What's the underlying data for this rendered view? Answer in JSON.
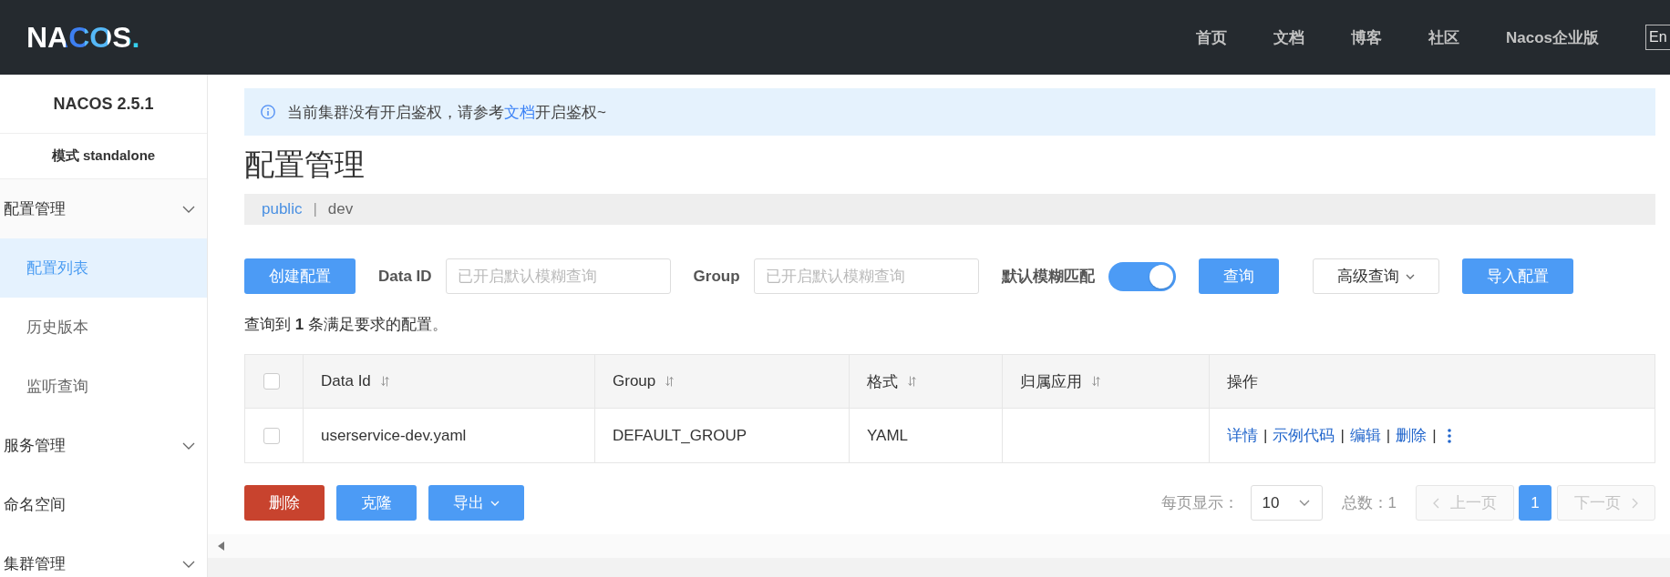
{
  "header": {
    "logo": "NACOS.",
    "nav": [
      {
        "label": "首页"
      },
      {
        "label": "文档"
      },
      {
        "label": "博客"
      },
      {
        "label": "社区"
      },
      {
        "label": "Nacos企业版"
      }
    ],
    "language": "En"
  },
  "sidebar": {
    "version": "NACOS 2.5.1",
    "mode": "模式 standalone",
    "items": [
      {
        "kind": "group",
        "label": "配置管理",
        "children": [
          {
            "label": "配置列表",
            "selected": true
          },
          {
            "label": "历史版本",
            "selected": false
          },
          {
            "label": "监听查询",
            "selected": false
          }
        ]
      },
      {
        "kind": "group",
        "label": "服务管理"
      },
      {
        "kind": "link",
        "label": "命名空间",
        "selected": false
      },
      {
        "kind": "group",
        "label": "集群管理"
      }
    ]
  },
  "notice": {
    "text_before": "当前集群没有开启鉴权，请参考",
    "link": "文档",
    "text_after": "开启鉴权~"
  },
  "page_title": "配置管理",
  "breadcrumb": {
    "namespaces": [
      {
        "label": "public",
        "selected": false
      },
      {
        "label": "dev",
        "selected": true
      }
    ],
    "separator": "|"
  },
  "toolbar": [
    {
      "kind": "primary",
      "label": "创建配置"
    },
    {
      "kind": "field",
      "label": "Data ID",
      "placeholder": "已开启默认模糊查询"
    },
    {
      "kind": "field",
      "label": "Group",
      "placeholder": "已开启默认模糊查询"
    },
    {
      "kind": "toggle",
      "label": "默认模糊匹配",
      "on": true
    },
    {
      "kind": "primary",
      "label": "查询"
    },
    {
      "kind": "secondary",
      "label": "高级查询",
      "dropdown": true
    },
    {
      "kind": "primary",
      "label": "导入配置"
    }
  ],
  "result_summary": "查询到 **1** 条满足要求的配置。",
  "table": {
    "select_all": {
      "checked": false
    },
    "columns": [
      {
        "label": "Data Id",
        "sortable": true
      },
      {
        "label": "Group",
        "sortable": true
      },
      {
        "label": "格式",
        "sortable": true
      },
      {
        "label": "归属应用",
        "sortable": true
      },
      {
        "label": "操作",
        "sortable": false
      }
    ],
    "rows": [
      {
        "checked": false,
        "data_id": "userservice-dev.yaml",
        "group": "DEFAULT_GROUP",
        "format": "YAML",
        "actions": [
          {
            "kind": "link",
            "label": "详情"
          },
          {
            "kind": "separator",
            "label": "|"
          },
          {
            "kind": "link",
            "label": "示例代码"
          },
          {
            "kind": "separator",
            "label": "|"
          },
          {
            "kind": "link",
            "label": "编辑"
          },
          {
            "kind": "separator",
            "label": "|"
          },
          {
            "kind": "link",
            "label": "删除"
          },
          {
            "kind": "separator",
            "label": "|"
          },
          {
            "kind": "more"
          }
        ]
      }
    ]
  },
  "batch_actions": [
    {
      "kind": "danger",
      "label": "删除"
    },
    {
      "kind": "primary",
      "label": "克隆"
    },
    {
      "kind": "primary",
      "label": "导出",
      "dropdown": true
    }
  ],
  "pagination": {
    "page_size_label": "每页显示：",
    "page_size": "10",
    "total": "总数：1",
    "previous": {
      "label": "上一页",
      "disabled": true
    },
    "pages": [
      {
        "label": "1",
        "selected": true
      }
    ],
    "next": {
      "label": "下一页",
      "disabled": true
    }
  }
}
